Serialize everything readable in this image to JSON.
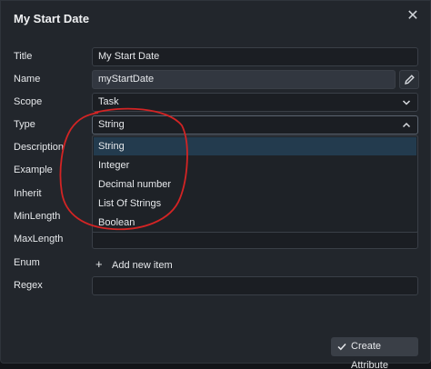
{
  "dialog": {
    "title": "My Start Date"
  },
  "fields": {
    "title": {
      "label": "Title",
      "value": "My Start Date"
    },
    "name": {
      "label": "Name",
      "value": "myStartDate"
    },
    "scope": {
      "label": "Scope",
      "value": "Task"
    },
    "type": {
      "label": "Type",
      "value": "String"
    },
    "description": {
      "label": "Description"
    },
    "example": {
      "label": "Example"
    },
    "inherit": {
      "label": "Inherit"
    },
    "minlength": {
      "label": "MinLength"
    },
    "maxlength": {
      "label": "MaxLength"
    },
    "enum": {
      "label": "Enum",
      "add_label": "Add new item"
    },
    "regex": {
      "label": "Regex",
      "value": ""
    }
  },
  "type_options": [
    "String",
    "Integer",
    "Decimal number",
    "List Of Strings",
    "Boolean"
  ],
  "buttons": {
    "create_label": "Create Attribute"
  },
  "icons": [
    "close-icon",
    "pencil-icon",
    "chevron-down-icon",
    "chevron-up-icon",
    "plus-icon",
    "check-icon"
  ],
  "colors": {
    "selected_option": "#233b4e",
    "annotation": "#d32424"
  }
}
